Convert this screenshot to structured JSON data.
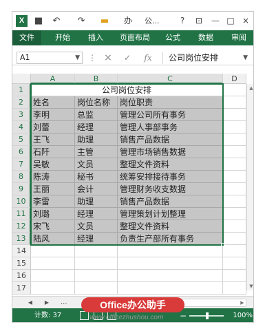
{
  "app": {
    "logo_letter": "X",
    "window_title": "公...",
    "qa_save": "■",
    "qa_undo": "↶",
    "qa_redo": "↷",
    "qa_folder": "▬",
    "qa_office": "办",
    "help": "?",
    "restore": "⊡",
    "minimize": "—",
    "maximize": "□",
    "close": "×"
  },
  "ribbon": {
    "tabs": [
      "文件",
      "开始",
      "插入",
      "页面布局",
      "公式",
      "数据",
      "审阅"
    ]
  },
  "formula_bar": {
    "name_box": "A1",
    "cancel": "×",
    "enter": "✓",
    "fx": "fx",
    "content": "公司岗位安排"
  },
  "columns": [
    "A",
    "B",
    "C",
    "D"
  ],
  "row_numbers": [
    "1",
    "2",
    "3",
    "4",
    "5",
    "6",
    "7",
    "8",
    "9",
    "10",
    "11",
    "12",
    "13",
    "14",
    "15",
    "16",
    "17"
  ],
  "sheet": {
    "title": "公司岗位安排",
    "headers": [
      "姓名",
      "岗位名称",
      "岗位职责"
    ],
    "rows": [
      [
        "李明",
        "总监",
        "管理公司所有事务"
      ],
      [
        "刘蕾",
        "经理",
        "管理人事部事务"
      ],
      [
        "王飞",
        "助理",
        "销售产品数据"
      ],
      [
        "石阡",
        "主管",
        "管理市场销售数据"
      ],
      [
        "吴敏",
        "文员",
        "整理文件资料"
      ],
      [
        "陈涛",
        "秘书",
        "统筹安排接待事务"
      ],
      [
        "王丽",
        "会计",
        "管理财务收支数据"
      ],
      [
        "李雷",
        "助理",
        "销售产品数据"
      ],
      [
        "刘璐",
        "经理",
        "管理策划计划整理"
      ],
      [
        "宋飞",
        "文员",
        "整理文件资料"
      ],
      [
        "陆风",
        "经理",
        "负责生产部所有事务"
      ]
    ]
  },
  "sheetbar": {
    "prev": "◀",
    "next": "▶",
    "ellipsis": "...",
    "scroll_left": "◀",
    "scroll_right": "▶"
  },
  "status": {
    "count": "计数: 37",
    "zoom_minus": "−",
    "zoom_plus": "+",
    "zoom": "100%"
  },
  "watermark": {
    "logo": "Office办公助手",
    "url": "www.officezhushou.com"
  },
  "colors": {
    "accent": "#217346",
    "selection": "#c6c6c6"
  }
}
